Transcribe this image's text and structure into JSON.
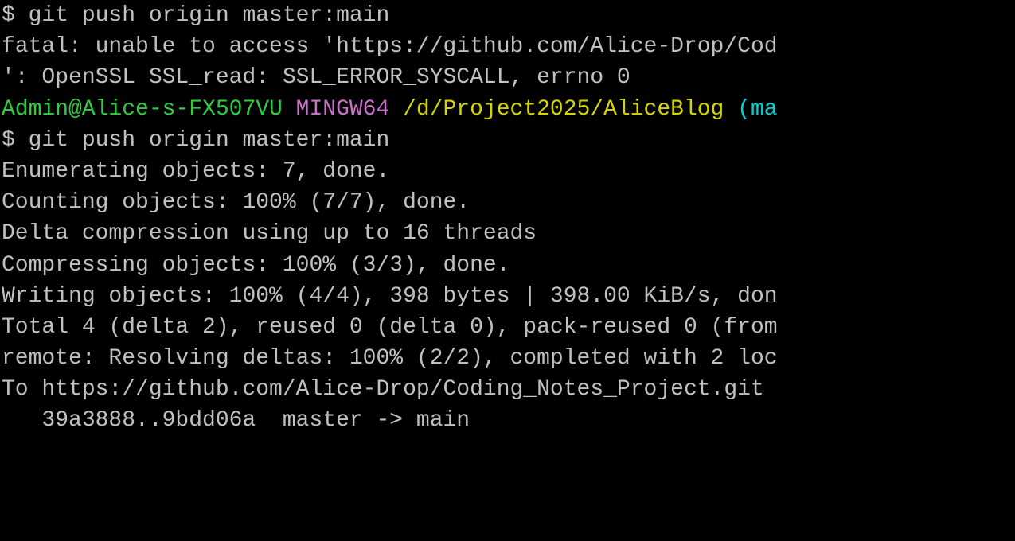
{
  "terminal": {
    "block0": {
      "prompt": "$ ",
      "command": "git push origin master:main",
      "fatal_line": "fatal: unable to access 'https://github.com/Alice-Drop/Cod",
      "ssl_line": "': OpenSSL SSL_read: SSL_ERROR_SYSCALL, errno 0"
    },
    "blank": "",
    "promptline": {
      "userhost": "Admin@Alice-s-FX507VU ",
      "mingw": "MINGW64 ",
      "path": "/d/Project2025/AliceBlog ",
      "branch": "(ma"
    },
    "block1": {
      "prompt": "$ ",
      "command": "git push origin master:main",
      "l1": "Enumerating objects: 7, done.",
      "l2": "Counting objects: 100% (7/7), done.",
      "l3": "Delta compression using up to 16 threads",
      "l4": "Compressing objects: 100% (3/3), done.",
      "l5": "Writing objects: 100% (4/4), 398 bytes | 398.00 KiB/s, don",
      "l6": "Total 4 (delta 2), reused 0 (delta 0), pack-reused 0 (from",
      "l7": "remote: Resolving deltas: 100% (2/2), completed with 2 loc",
      "l8": "To https://github.com/Alice-Drop/Coding_Notes_Project.git",
      "l9": "   39a3888..9bdd06a  master -> main"
    }
  }
}
